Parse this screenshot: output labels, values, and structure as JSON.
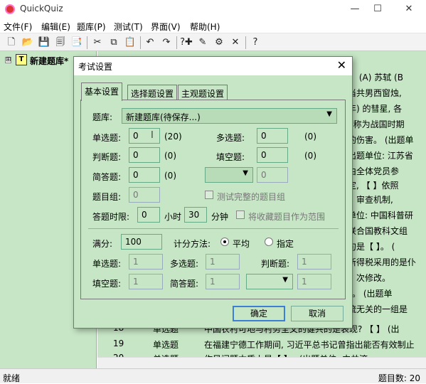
{
  "app": {
    "title": "QuickQuiz",
    "minimize": "—",
    "maximize": "☐",
    "close": "✕"
  },
  "menu": [
    "文件(F)",
    "编辑(E)",
    "题库(P)",
    "测试(T)",
    "界面(V)",
    "帮助(H)"
  ],
  "toolbar_icons": [
    {
      "name": "new-file-icon",
      "glyph": "🗋"
    },
    {
      "name": "open-icon",
      "glyph": "📂"
    },
    {
      "name": "save-icon",
      "glyph": "💾"
    },
    {
      "name": "save-all-icon",
      "glyph": "🗐"
    },
    {
      "name": "library-icon",
      "glyph": "📑"
    },
    {
      "name": "cut-icon",
      "glyph": "✂"
    },
    {
      "name": "copy-icon",
      "glyph": "⧉"
    },
    {
      "name": "paste-icon",
      "glyph": "📋"
    },
    {
      "name": "undo-icon",
      "glyph": "↶"
    },
    {
      "name": "redo-icon",
      "glyph": "↷"
    },
    {
      "name": "add-question-icon",
      "glyph": "?✚"
    },
    {
      "name": "edit-question-icon",
      "glyph": "✎"
    },
    {
      "name": "question-settings-icon",
      "glyph": "⚙"
    },
    {
      "name": "delete-icon",
      "glyph": "✕"
    },
    {
      "name": "help-icon",
      "glyph": "?"
    }
  ],
  "tree": {
    "expander": "⊞",
    "icon_letter": "T",
    "root_label": "新建题库*"
  },
  "background_text": [
    "】 (A) 苏轼 (B",
    "当共男西窗烛, ",
    "年) 的彗星, 各",
    ", 称为战国时期",
    "的伤害。 (出题单",
    "出题单位: 江苏省",
    "由全体党员参",
    "定, 【 】依照",
    "】审查机制, ",
    "单位: 中国科普研",
    "联合国教科文组",
    "句是【 】。 (",
    "新得税采用的是仆",
    "】次修改。",
    "】。 (出题单",
    "流无关的一组是"
  ],
  "bottom_rows": [
    {
      "no": "18",
      "type": "单选题",
      "content": "中国农村可地与村务全文的健共的是表现?  【   】 (出"
    },
    {
      "no": "19",
      "type": "单选题",
      "content": "在福建宁德工作期间, 习近平总书记曾指出能否有效制止"
    },
    {
      "no": "20",
      "type": "单选题",
      "content": "作风问题本质上是【   】。 (出题单位: 中共济"
    }
  ],
  "status": {
    "left": "就绪",
    "right": "题目数: 20"
  },
  "dialog": {
    "title": "考试设置",
    "close": "✕",
    "tabs": [
      "基本设置",
      "选择题设置",
      "主观题设置"
    ],
    "library_label": "题库:",
    "library_value": "新建题库(待保存...)",
    "single_label": "单选题:",
    "single_value": "0",
    "single_count": "(20)",
    "multi_label": "多选题:",
    "multi_value": "0",
    "multi_count": "(0)",
    "judge_label": "判断题:",
    "judge_value": "0",
    "judge_count": "(0)",
    "fill_label": "填空题:",
    "fill_value": "0",
    "fill_count": "(0)",
    "short_label": "简答题:",
    "short_value": "0",
    "short_count": "(0)",
    "extra_select": "",
    "extra_value": "0",
    "group_label": "题目组:",
    "group_value": "0",
    "test_complete_label": "测试完整的题目组",
    "time_label": "答题时限:",
    "hours_value": "0",
    "hours_unit": "小时",
    "minutes_value": "30",
    "minutes_unit": "分钟",
    "favorites_label": "将收藏题目作为范围",
    "full_score_label": "满分:",
    "full_score_value": "100",
    "method_label": "计分方法:",
    "method_avg": "平均",
    "method_specify": "指定",
    "s_single_label": "单选题:",
    "s_single_value": "1",
    "s_multi_label": "多选题:",
    "s_multi_value": "1",
    "s_judge_label": "判断题:",
    "s_judge_value": "1",
    "s_fill_label": "填空题:",
    "s_fill_value": "1",
    "s_short_label": "简答题:",
    "s_short_value": "1",
    "s_extra_value": "1",
    "ok": "确定",
    "cancel": "取消"
  }
}
